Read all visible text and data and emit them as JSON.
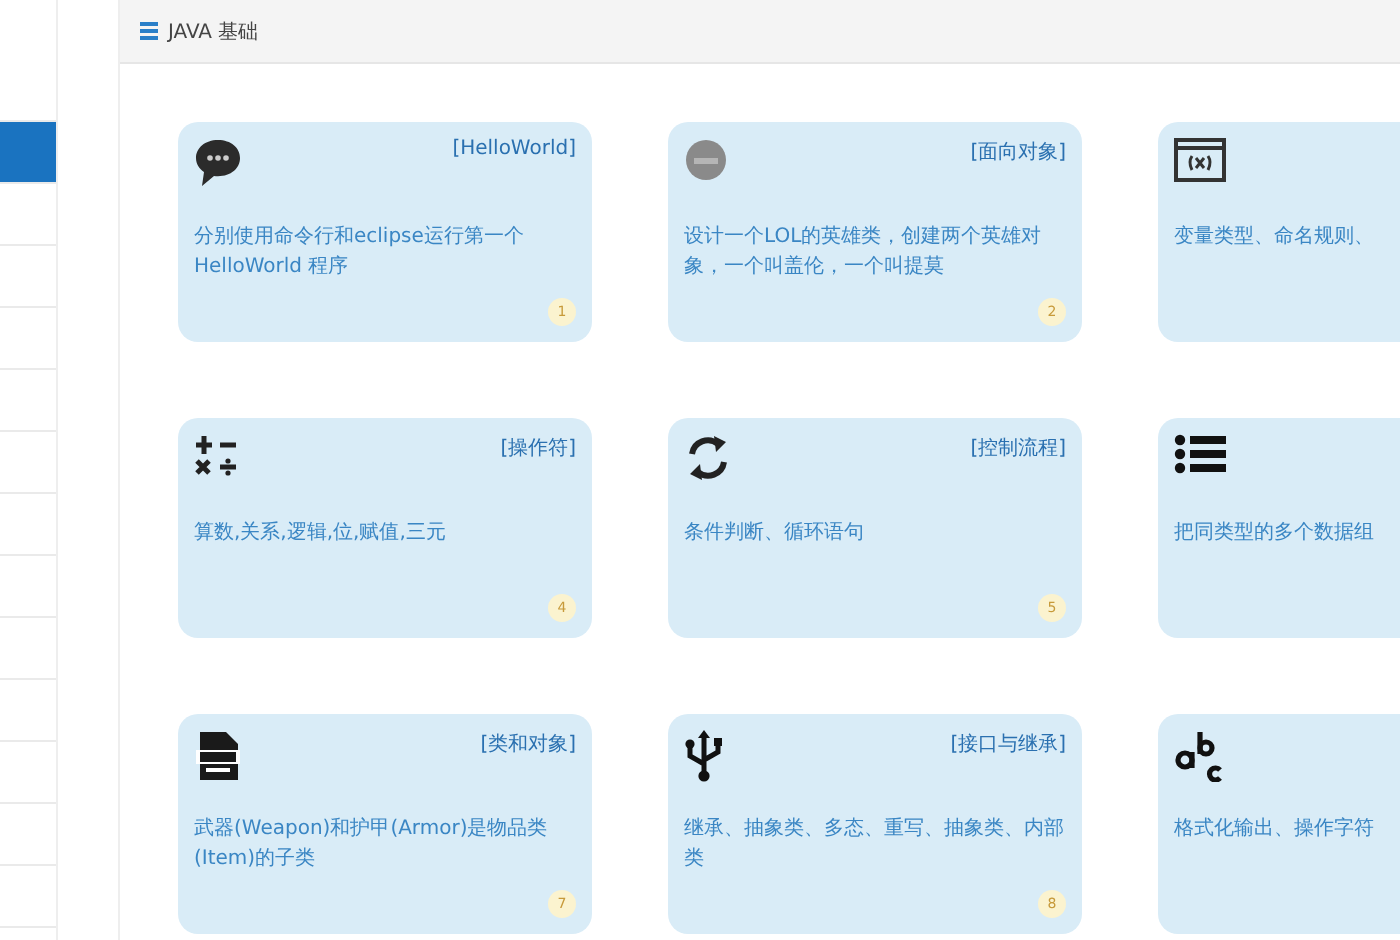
{
  "sidebar": {
    "items": [
      {
        "selected": false
      },
      {
        "selected": true
      },
      {
        "selected": false
      },
      {
        "selected": false
      },
      {
        "selected": false
      },
      {
        "selected": false
      },
      {
        "selected": false
      },
      {
        "selected": false
      },
      {
        "selected": false
      },
      {
        "selected": false
      },
      {
        "selected": false
      },
      {
        "selected": false
      },
      {
        "selected": false
      },
      {
        "selected": false
      }
    ]
  },
  "panel": {
    "title": "JAVA 基础"
  },
  "cards": [
    {
      "title": "[HelloWorld]",
      "text": "分别使用命令行和eclipse运行第一个 HelloWorld 程序",
      "number": "1"
    },
    {
      "title": "[面向对象]",
      "text": "设计一个LOL的英雄类，创建两个英雄对象，一个叫盖伦，一个叫提莫",
      "number": "2"
    },
    {
      "text": "变量类型、命名规则、"
    },
    {
      "title": "[操作符]",
      "text": "算数,关系,逻辑,位,赋值,三元",
      "number": "4"
    },
    {
      "title": "[控制流程]",
      "text": "条件判断、循环语句",
      "number": "5"
    },
    {
      "text": "把同类型的多个数据组"
    },
    {
      "title": "[类和对象]",
      "text": "武器(Weapon)和护甲(Armor)是物品类(Item)的子类",
      "number": "7"
    },
    {
      "title": "[接口与继承]",
      "text": "继承、抽象类、多态、重写、抽象类、内部类",
      "number": "8"
    },
    {
      "text": "格式化输出、操作字符"
    }
  ]
}
